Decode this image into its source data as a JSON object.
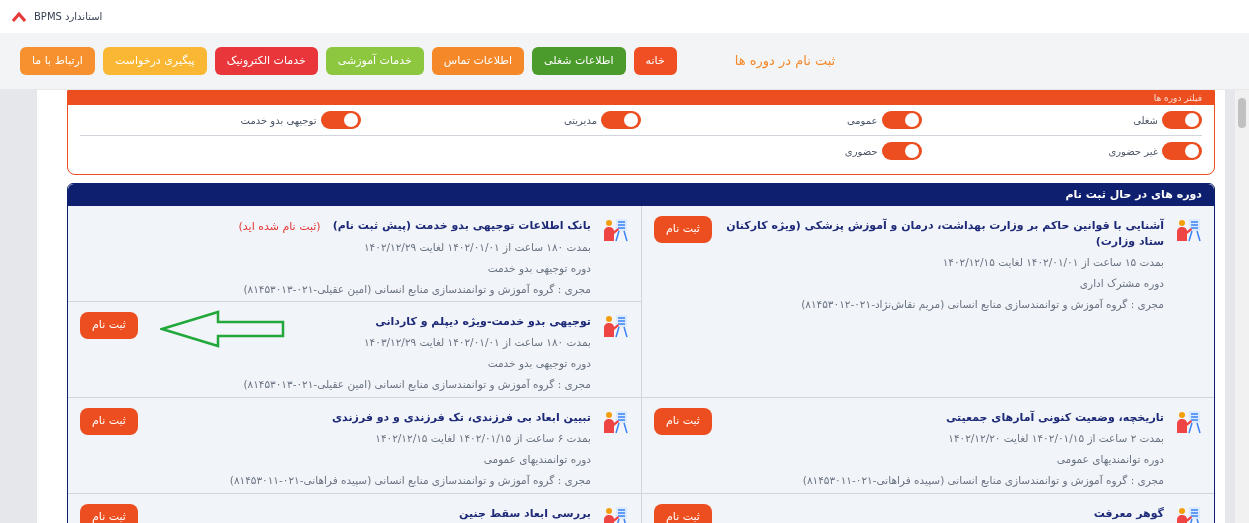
{
  "window": {
    "title": "استاندارد BPMS"
  },
  "nav": {
    "buttons": [
      {
        "label": "خانه",
        "color": "#f04e23"
      },
      {
        "label": "اطلاعات شغلی",
        "color": "#4b9a2c"
      },
      {
        "label": "اطلاعات تماس",
        "color": "#f5892a"
      },
      {
        "label": "خدمات آموزشی",
        "color": "#8dc63f"
      },
      {
        "label": "خدمات الکترونیک",
        "color": "#e8363b"
      },
      {
        "label": "پیگیری درخواست",
        "color": "#f9b733"
      },
      {
        "label": "ارتباط با ما",
        "color": "#f7912f"
      }
    ],
    "page_title": "ثبت نام در دوره ها"
  },
  "filter": {
    "title": "فیلتر دوره ها",
    "rows": [
      [
        {
          "label": "شغلی",
          "on": true
        },
        {
          "label": "عمومی",
          "on": true
        },
        {
          "label": "مدیریتی",
          "on": true
        },
        {
          "label": "توجیهی بدو خدمت",
          "on": true
        }
      ],
      [
        {
          "label": "غیر حضوری",
          "on": true
        },
        {
          "label": "حضوری",
          "on": true
        }
      ]
    ]
  },
  "courses": {
    "title": "دوره های در حال ثبت نام",
    "rows": [
      {
        "cells": [
          [
            {
              "title": "آشنایی با قوانین حاکم بر وزارت بهداشت، درمان و آموزش پزشکی (ویژه کارکنان ستاد وزارت)",
              "duration": "بمدت ۱۵ ساعت از ۱۴۰۲/۰۱/۰۱ لغایت ۱۴۰۲/۱۲/۱۵",
              "category": "دوره مشترک اداری",
              "executor": "مجری : گروه آموزش و توانمندسازی منابع انسانی (مریم نقاش‌نژاد-۰۲۱-۸۱۴۵۳۰۱۲)",
              "button": "ثبت نام"
            }
          ],
          [
            {
              "title": "بانک اطلاعات توجیهی بدو خدمت (پیش ثبت نام)",
              "note": "(ثبت نام شده اید)",
              "duration": "بمدت ۱۸۰ ساعت از ۱۴۰۲/۰۱/۰۱ لغایت ۱۴۰۲/۱۲/۲۹",
              "category": "دوره توجیهی بدو خدمت",
              "executor": "مجری : گروه آموزش و توانمندسازی منابع انسانی (امین عقیلی-۰۲۱-۸۱۴۵۳۰۱۳)"
            },
            {
              "title": "توجیهی بدو خدمت-ویژه دیپلم و کاردانی",
              "duration": "بمدت ۱۸۰ ساعت از ۱۴۰۲/۰۱/۰۱ لغایت ۱۴۰۳/۱۲/۲۹",
              "category": "دوره توجیهی بدو خدمت",
              "executor": "مجری : گروه آموزش و توانمندسازی منابع انسانی (امین عقیلی-۰۲۱-۸۱۴۵۳۰۱۳)",
              "button": "ثبت نام",
              "annotated": true
            }
          ]
        ]
      },
      {
        "cells": [
          [
            {
              "title": "تاریخچه، وضعیت کنونی آمارهای جمعیتی",
              "duration": "بمدت ۲ ساعت از ۱۴۰۲/۰۱/۱۵ لغایت ۱۴۰۲/۱۲/۲۰",
              "category": "دوره توانمندیهای عمومی",
              "executor": "مجری : گروه آموزش و توانمندسازی منابع انسانی (سپیده فراهانی-۰۲۱-۸۱۴۵۳۰۱۱)",
              "button": "ثبت نام"
            }
          ],
          [
            {
              "title": "تبیین ابعاد بی فرزندی، تک فرزندی و دو فرزندی",
              "duration": "بمدت ۶ ساعت از ۱۴۰۲/۰۱/۱۵ لغایت ۱۴۰۲/۱۲/۱۵",
              "category": "دوره توانمندیهای عمومی",
              "executor": "مجری : گروه آموزش و توانمندسازی منابع انسانی (سپیده فراهانی-۰۲۱-۸۱۴۵۳۰۱۱)",
              "button": "ثبت نام"
            }
          ]
        ]
      },
      {
        "cells": [
          [
            {
              "title": "گوهر معرفت",
              "button": "ثبت نام"
            }
          ],
          [
            {
              "title": "بررسی ابعاد سقط جنین",
              "button": "ثبت نام"
            }
          ]
        ]
      }
    ]
  }
}
